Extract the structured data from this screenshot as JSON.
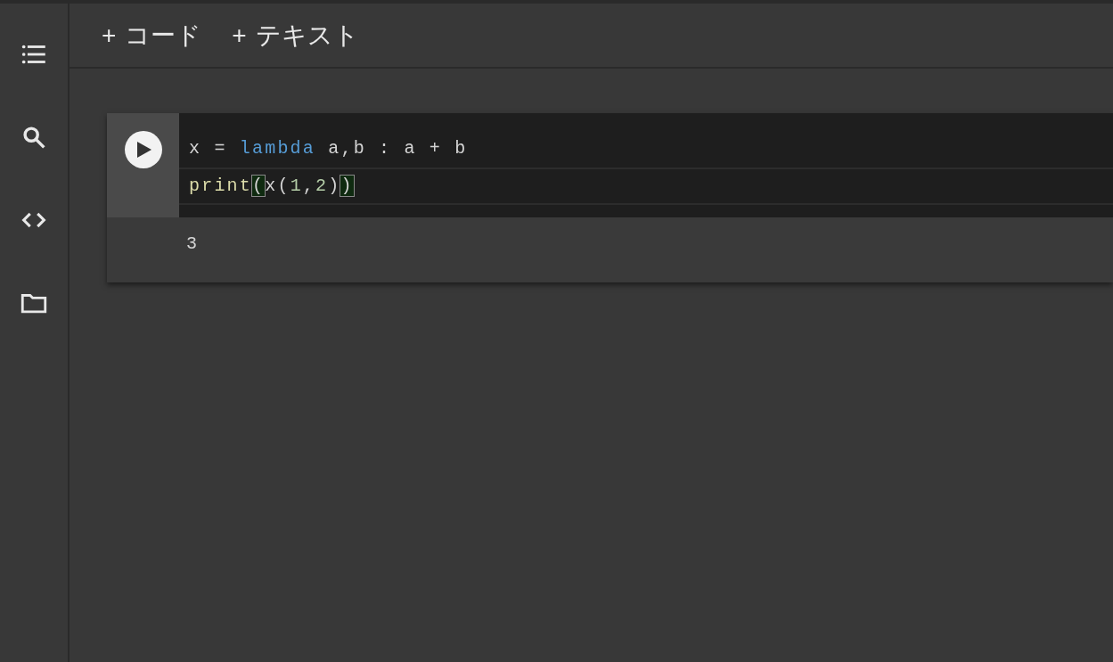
{
  "sidebar": {
    "items": [
      {
        "kind": "toc"
      },
      {
        "kind": "search"
      },
      {
        "kind": "snippets"
      },
      {
        "kind": "files"
      }
    ]
  },
  "toolbar": {
    "buttons": [
      {
        "icon": "+",
        "label": "コード"
      },
      {
        "icon": "+",
        "label": "テキスト"
      }
    ]
  },
  "cell": {
    "lines": [
      {
        "current": false,
        "tokens": [
          {
            "kind": "plain",
            "text": "x = "
          },
          {
            "kind": "keyword",
            "text": "lambda"
          },
          {
            "kind": "plain",
            "text": " a,b : a + b"
          }
        ]
      },
      {
        "current": true,
        "tokens": [
          {
            "kind": "builtin",
            "text": "print"
          },
          {
            "kind": "bracket",
            "text": "("
          },
          {
            "kind": "plain",
            "text": "x("
          },
          {
            "kind": "number",
            "text": "1"
          },
          {
            "kind": "plain",
            "text": ","
          },
          {
            "kind": "number",
            "text": "2"
          },
          {
            "kind": "plain",
            "text": ")"
          },
          {
            "kind": "bracket",
            "text": ")"
          }
        ]
      }
    ],
    "output": "3"
  }
}
